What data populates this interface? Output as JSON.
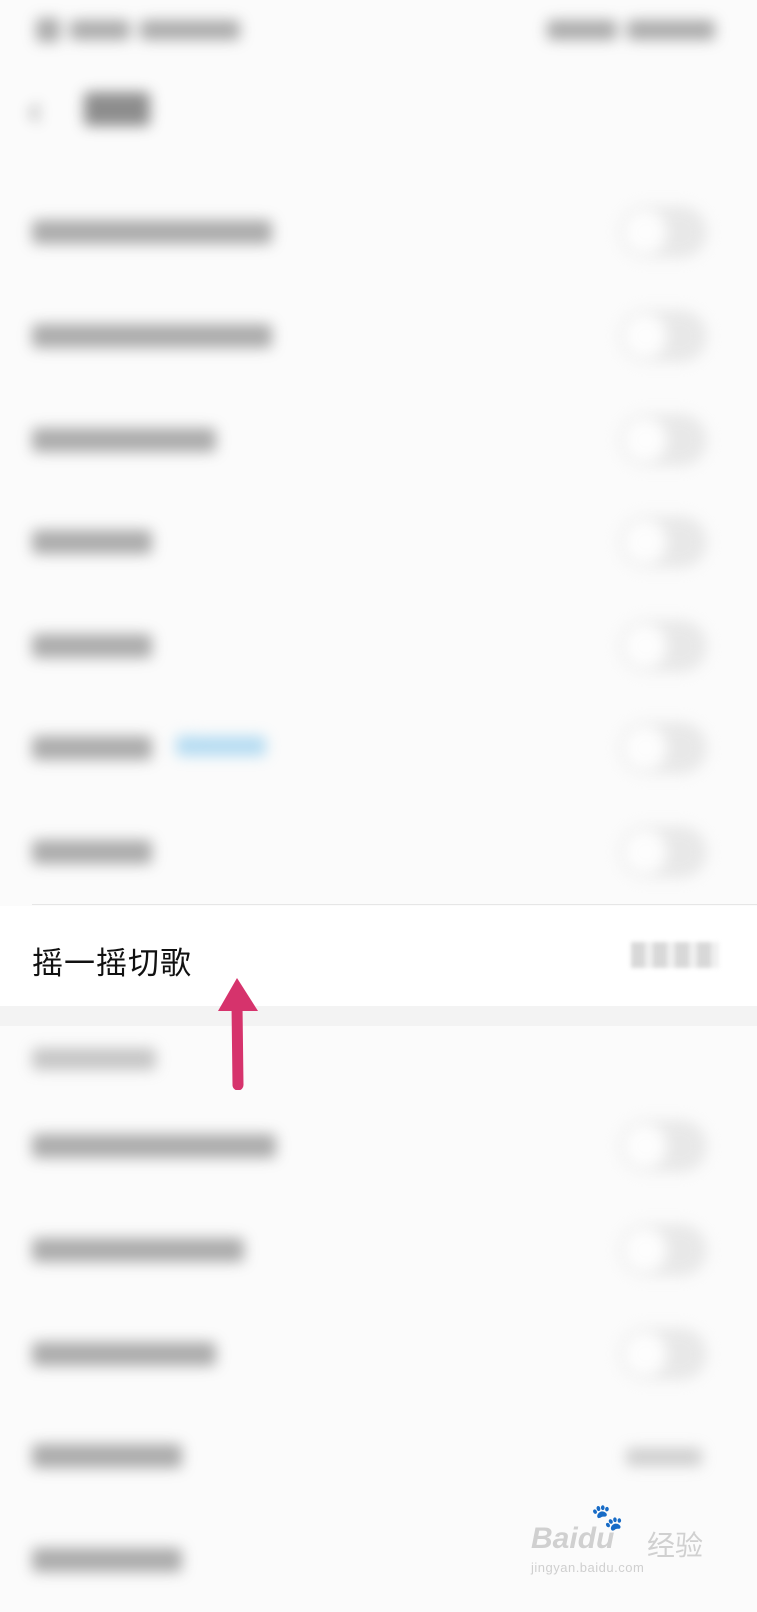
{
  "status_bar": {
    "left_text": "",
    "right_text": ""
  },
  "header": {
    "back_icon": "‹",
    "title": ""
  },
  "settings_rows": [
    {
      "label": "",
      "toggle": "off"
    },
    {
      "label": "",
      "toggle": "off"
    },
    {
      "label": "",
      "toggle": "off"
    },
    {
      "label": "",
      "toggle": "off"
    },
    {
      "label": "",
      "toggle": "off"
    },
    {
      "label": "",
      "badge": "",
      "toggle": "off"
    },
    {
      "label": "",
      "toggle": "off"
    }
  ],
  "shake_row": {
    "label": "摇一摇切歌",
    "value": ""
  },
  "section": {
    "title": ""
  },
  "tools_rows": [
    {
      "label": "",
      "toggle": "off"
    },
    {
      "label": "",
      "toggle": "off"
    },
    {
      "label": "",
      "toggle": "off"
    },
    {
      "label": "",
      "value": ""
    },
    {
      "label": ""
    }
  ],
  "colors": {
    "arrow": "#d6336c",
    "toggle_off": "#d9d9d9",
    "badge": "#5aa9d8"
  },
  "icons": {
    "back": "chevron-left-icon",
    "arrow": "up-arrow-annotation"
  },
  "watermark": {
    "brand": "Bai",
    "paw": "🐾",
    "brand_suffix": "du",
    "cn": "经验",
    "url": "jingyan.baidu.com"
  }
}
